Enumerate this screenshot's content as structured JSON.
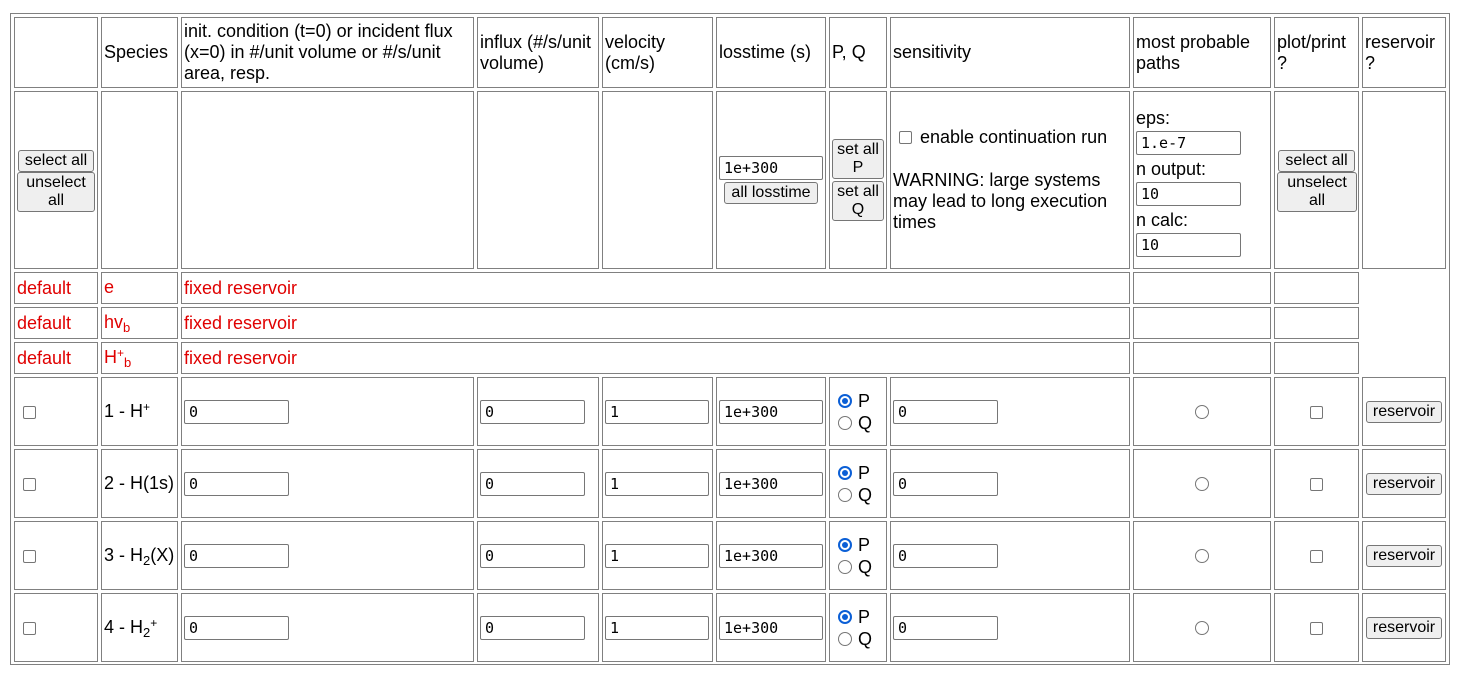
{
  "headers": {
    "species": "Species",
    "init": "init. condition (t=0) or incident flux (x=0) in #/unit volume or #/s/unit area, resp.",
    "influx": "influx (#/s/unit volume)",
    "velocity": "velocity (cm/s)",
    "losstime": "losstime (s)",
    "pq": "P, Q",
    "sensitivity": "sensitivity",
    "paths": "most probable paths",
    "plot": "plot/print ?",
    "reservoir": "reservoir ?"
  },
  "controls": {
    "select_all": "select all",
    "unselect_all": "unselect all",
    "losstime_value": "1e+300",
    "all_losstime": "all losstime",
    "set_all_p": "set all P",
    "set_all_q": "set all Q",
    "continuation_label": "enable continuation run",
    "warning": "WARNING: large systems may lead to long execution times",
    "eps_label": "eps:",
    "eps_value": "1.e-7",
    "n_output_label": "n output:",
    "n_output_value": "10",
    "n_calc_label": "n calc:",
    "n_calc_value": "10",
    "plot_select_all": "select all",
    "plot_unselect_all": "unselect all"
  },
  "defaults": [
    {
      "label": "default",
      "species_base": "e",
      "species_sup": "",
      "species_sub": "",
      "text": "fixed reservoir"
    },
    {
      "label": "default",
      "species_base": "hv",
      "species_sup": "",
      "species_sub": "b",
      "text": "fixed reservoir"
    },
    {
      "label": "default",
      "species_base": "H",
      "species_sup": "+",
      "species_sub": "b",
      "text": "fixed reservoir"
    }
  ],
  "species": [
    {
      "name_pre": "1 - H",
      "name_sub": "",
      "name_sup": "+",
      "name_post": "",
      "init": "0",
      "influx": "0",
      "velocity": "1",
      "losstime": "1e+300",
      "p_label": "P",
      "q_label": "Q",
      "selected": "P",
      "sensitivity": "0",
      "reservoir_button": "reservoir"
    },
    {
      "name_pre": "2 - H(1s)",
      "name_sub": "",
      "name_sup": "",
      "name_post": "",
      "init": "0",
      "influx": "0",
      "velocity": "1",
      "losstime": "1e+300",
      "p_label": "P",
      "q_label": "Q",
      "selected": "P",
      "sensitivity": "0",
      "reservoir_button": "reservoir"
    },
    {
      "name_pre": "3 - H",
      "name_sub": "2",
      "name_sup": "",
      "name_post": "(X)",
      "init": "0",
      "influx": "0",
      "velocity": "1",
      "losstime": "1e+300",
      "p_label": "P",
      "q_label": "Q",
      "selected": "P",
      "sensitivity": "0",
      "reservoir_button": "reservoir"
    },
    {
      "name_pre": "4 - H",
      "name_sub": "2",
      "name_sup": "+",
      "name_post": "",
      "init": "0",
      "influx": "0",
      "velocity": "1",
      "losstime": "1e+300",
      "p_label": "P",
      "q_label": "Q",
      "selected": "P",
      "sensitivity": "0",
      "reservoir_button": "reservoir"
    }
  ],
  "colors": {
    "default_text": "#e00000",
    "radio_accent": "#0b5fd6",
    "border": "#808080"
  }
}
